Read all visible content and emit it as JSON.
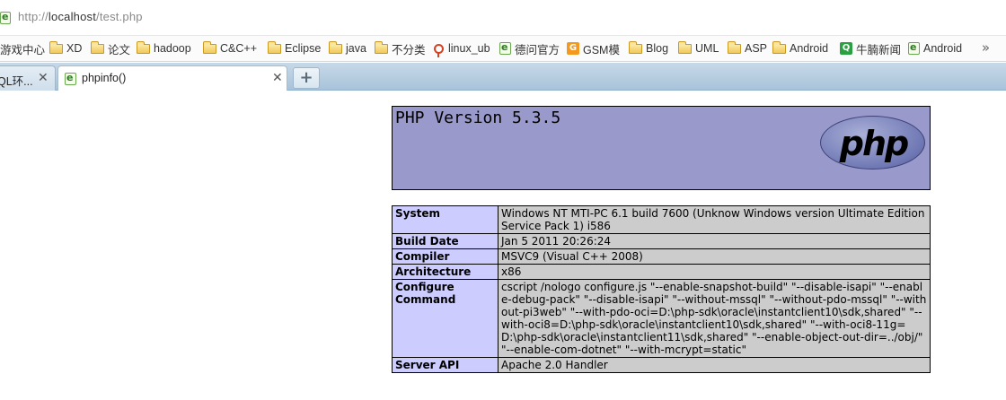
{
  "address_bar": {
    "url_prefix": "http://",
    "url_host": "localhost",
    "url_path": "/test.php"
  },
  "bookmarks": [
    {
      "label": "游戏中心",
      "icon": "none"
    },
    {
      "label": "XD",
      "icon": "folder-icon"
    },
    {
      "label": "论文",
      "icon": "folder-icon"
    },
    {
      "label": "hadoop",
      "icon": "folder-icon"
    },
    {
      "label": "C&C++",
      "icon": "folder-icon"
    },
    {
      "label": "Eclipse",
      "icon": "folder-icon"
    },
    {
      "label": "java",
      "icon": "folder-icon"
    },
    {
      "label": "不分类",
      "icon": "folder-icon"
    },
    {
      "label": "linux_ub",
      "icon": "pin-icon"
    },
    {
      "label": "德问官方",
      "icon": "ie-page-icon"
    },
    {
      "label": "GSM模",
      "icon": "gsm-icon"
    },
    {
      "label": "Blog",
      "icon": "folder-icon"
    },
    {
      "label": "UML",
      "icon": "folder-icon"
    },
    {
      "label": "ASP",
      "icon": "folder-icon"
    },
    {
      "label": "Android",
      "icon": "folder-icon"
    },
    {
      "label": "牛腩新闻",
      "icon": "green-search-icon"
    },
    {
      "label": "Android",
      "icon": "ie-page-icon"
    }
  ],
  "bookmarks_more": "»",
  "tabs": [
    {
      "label": "QL环...",
      "active": false,
      "close": "✕"
    },
    {
      "label": "phpinfo()",
      "active": true,
      "close": "✕"
    }
  ],
  "new_tab": "+",
  "phpinfo": {
    "version_title": "PHP Version 5.3.5",
    "logo_text": "php",
    "rows": [
      {
        "key": "System",
        "value": "Windows NT MTI-PC 6.1 build 7600 (Unknow Windows version Ultimate Edition Service Pack 1) i586"
      },
      {
        "key": "Build Date",
        "value": "Jan 5 2011 20:26:24"
      },
      {
        "key": "Compiler",
        "value": "MSVC9 (Visual C++ 2008)"
      },
      {
        "key": "Architecture",
        "value": "x86"
      },
      {
        "key": "Configure Command",
        "value": "cscript /nologo configure.js \"--enable-snapshot-build\" \"--disable-isapi\" \"--enable-debug-pack\" \"--disable-isapi\" \"--without-mssql\" \"--without-pdo-mssql\" \"--without-pi3web\" \"--with-pdo-oci=D:\\php-sdk\\oracle\\instantclient10\\sdk,shared\" \"--with-oci8=D:\\php-sdk\\oracle\\instantclient10\\sdk,shared\" \"--with-oci8-11g=D:\\php-sdk\\oracle\\instantclient11\\sdk,shared\" \"--enable-object-out-dir=../obj/\" \"--enable-com-dotnet\" \"--with-mcrypt=static\""
      },
      {
        "key": "Server API",
        "value": "Apache 2.0 Handler"
      }
    ]
  },
  "colors": {
    "header_bg": "#9999cc",
    "key_bg": "#ccccff",
    "value_bg": "#cccccc"
  }
}
